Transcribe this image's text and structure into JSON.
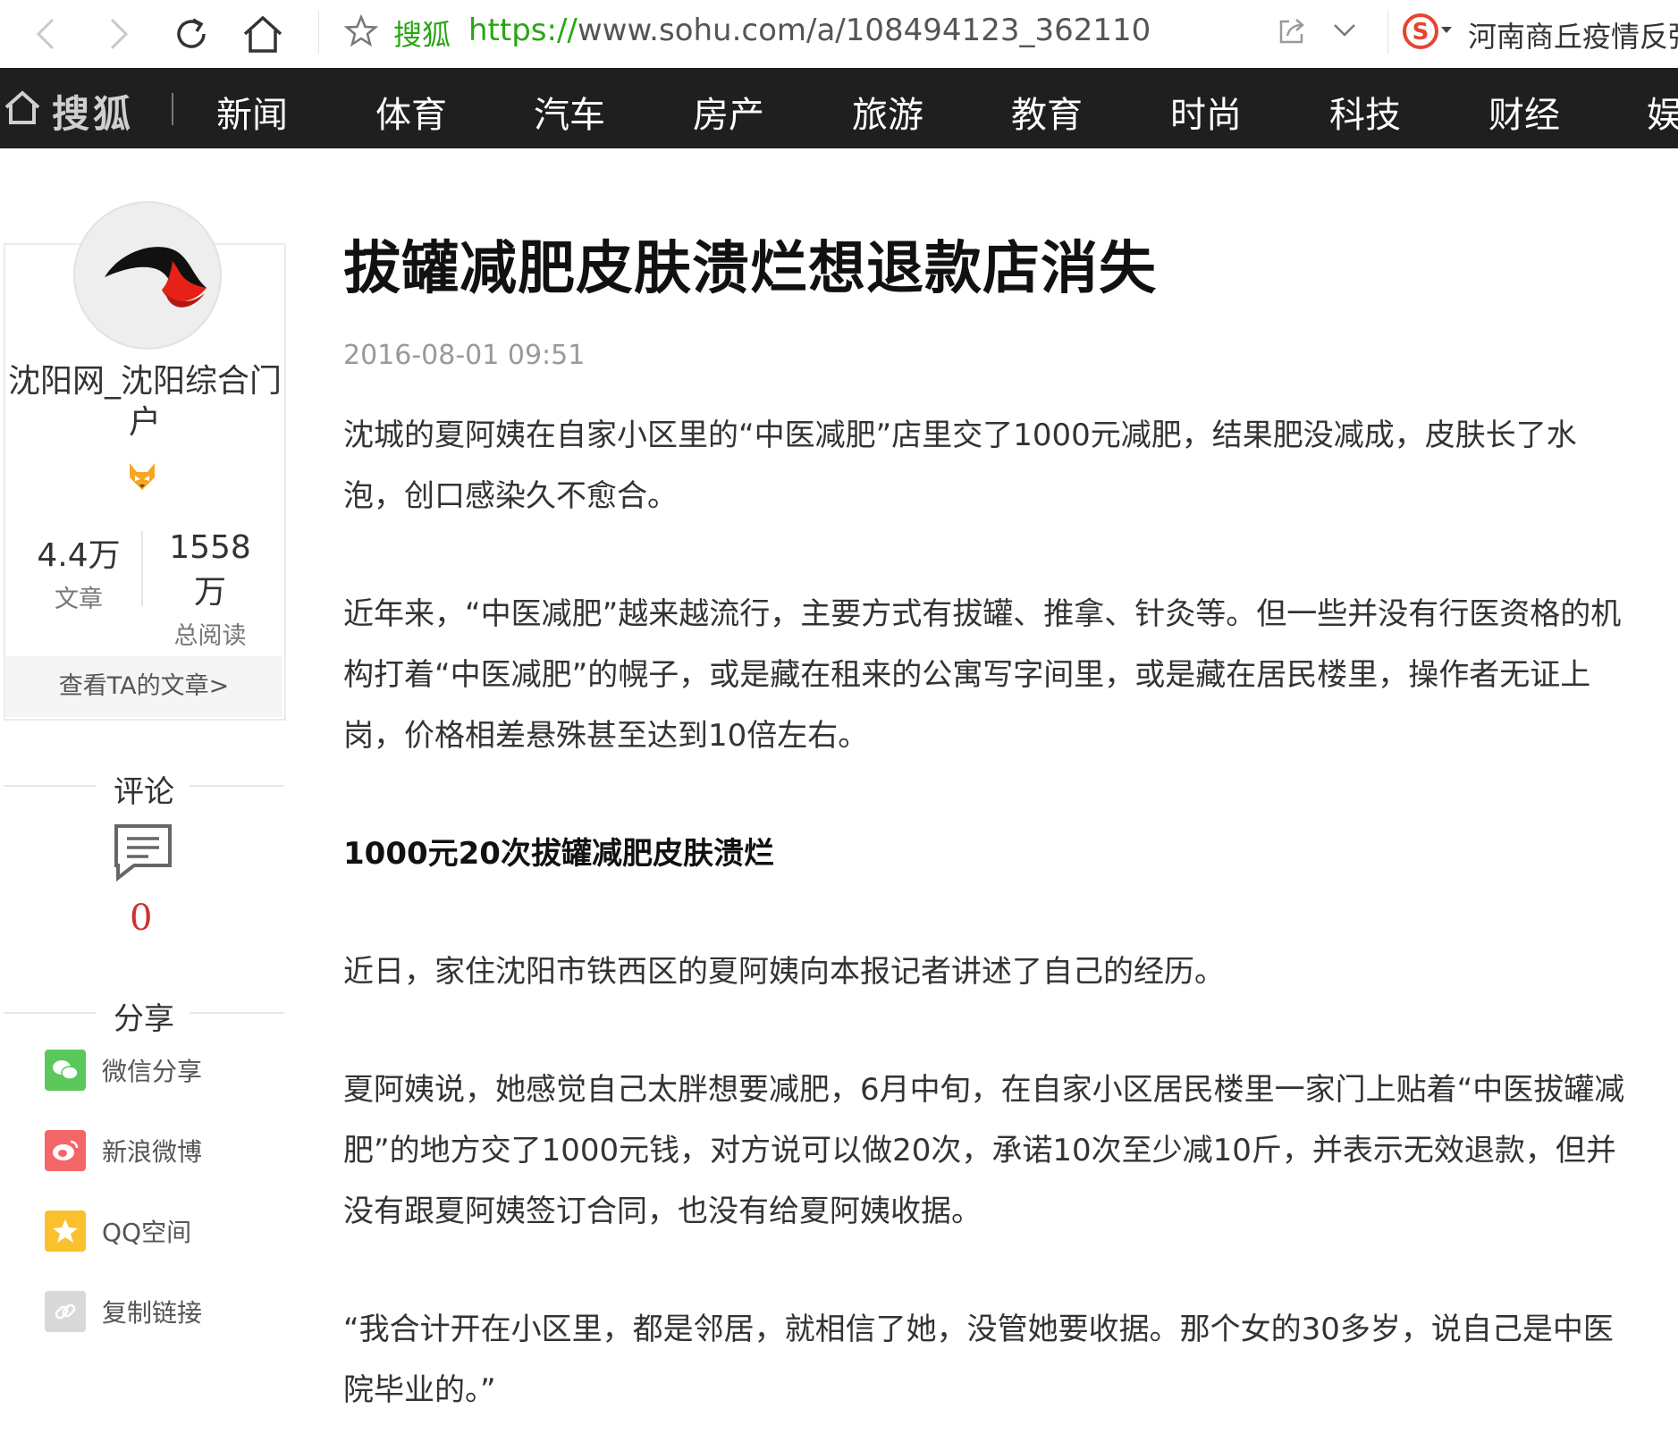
{
  "browser": {
    "site_name": "搜狐",
    "url_scheme": "https://",
    "url_rest": "www.sohu.com/a/108494123_362110",
    "search_text": "河南商丘疫情反弹"
  },
  "nav": {
    "logo": "搜狐",
    "items": [
      "新闻",
      "体育",
      "汽车",
      "房产",
      "旅游",
      "教育",
      "时尚",
      "科技",
      "财经",
      "娱"
    ]
  },
  "author": {
    "name": "沈阳网_沈阳综合门户",
    "articles_count": "4.4万",
    "articles_label": "文章",
    "reads_count": "1558万",
    "reads_label": "总阅读",
    "view_link": "查看TA的文章>"
  },
  "comments": {
    "heading": "评论",
    "count": "0"
  },
  "share": {
    "heading": "分享",
    "items": [
      {
        "label": "微信分享",
        "icon": "wechat-icon",
        "color": "#5ac85a"
      },
      {
        "label": "新浪微博",
        "icon": "weibo-icon",
        "color": "#f56668"
      },
      {
        "label": "QQ空间",
        "icon": "qzone-icon",
        "color": "#fbc02d"
      },
      {
        "label": "复制链接",
        "icon": "link-icon",
        "color": "#d9d9d9"
      }
    ]
  },
  "article": {
    "title": "拔罐减肥皮肤溃烂想退款店消失",
    "date": "2016-08-01 09:51",
    "p1": "沈城的夏阿姨在自家小区里的“中医减肥”店里交了1000元减肥，结果肥没减成，皮肤长了水泡，创口感染久不愈合。",
    "p2": "近年来，“中医减肥”越来越流行，主要方式有拔罐、推拿、针灸等。但一些并没有行医资格的机构打着“中医减肥”的幌子，或是藏在租来的公寓写字间里，或是藏在居民楼里，操作者无证上岗，价格相差悬殊甚至达到10倍左右。",
    "subtitle": "1000元20次拔罐减肥皮肤溃烂",
    "p3": "近日，家住沈阳市铁西区的夏阿姨向本报记者讲述了自己的经历。",
    "p4": "夏阿姨说，她感觉自己太胖想要减肥，6月中旬，在自家小区居民楼里一家门上贴着“中医拔罐减肥”的地方交了1000元钱，对方说可以做20次，承诺10次至少减10斤，并表示无效退款，但并没有跟夏阿姨签订合同，也没有给夏阿姨收据。",
    "p5": "“我合计开在小区里，都是邻居，就相信了她，没管她要收据。那个女的30多岁，说自己是中医院毕业的。”"
  },
  "colors": {
    "nav_bg": "#1f1f1f",
    "url_green": "#2aa515",
    "comment_red": "#d0312d"
  }
}
